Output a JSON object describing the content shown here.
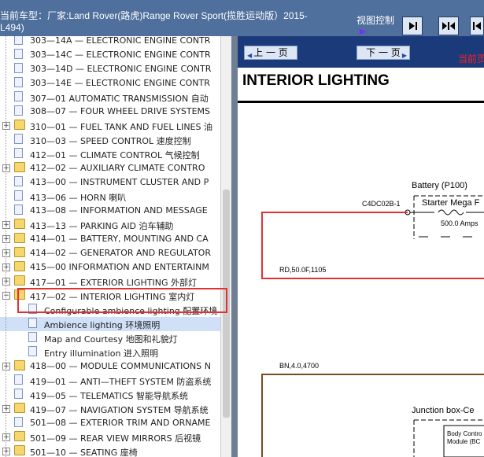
{
  "title": {
    "line1": "当前车型：厂家:Land Rover(路虎)Range Rover Sport(揽胜运动版）2015-",
    "line2": "L494)"
  },
  "view_control": {
    "label": "视图控制"
  },
  "tree": {
    "items": [
      {
        "label": "303—14A — ELECTRONIC ENGINE CONTR",
        "type": "doc",
        "expand": ""
      },
      {
        "label": "303—14C — ELECTRONIC ENGINE CONTR",
        "type": "doc",
        "expand": ""
      },
      {
        "label": "303—14D — ELECTRONIC ENGINE CONTR",
        "type": "doc",
        "expand": ""
      },
      {
        "label": "303—14E — ELECTRONIC ENGINE CONTR",
        "type": "doc",
        "expand": ""
      },
      {
        "label": "307—01 AUTOMATIC TRANSMISSION 自动",
        "type": "doc",
        "expand": ""
      },
      {
        "label": "308—07 — FOUR WHEEL DRIVE SYSTEMS",
        "type": "doc",
        "expand": ""
      },
      {
        "label": "310—01 — FUEL TANK AND FUEL LINES 油",
        "type": "folder",
        "expand": "+"
      },
      {
        "label": "310—03 — SPEED CONTROL 速度控制",
        "type": "doc",
        "expand": ""
      },
      {
        "label": "412—01 — CLIMATE CONTROL 气候控制",
        "type": "doc",
        "expand": ""
      },
      {
        "label": "412—02 — AUXILIARY CLIMATE CONTRO",
        "type": "folder",
        "expand": "+"
      },
      {
        "label": "413—00 — INSTRUMENT CLUSTER AND P",
        "type": "doc",
        "expand": ""
      },
      {
        "label": "413—06 — HORN 喇叭",
        "type": "doc",
        "expand": ""
      },
      {
        "label": "413—08 — INFORMATION AND MESSAGE",
        "type": "doc",
        "expand": ""
      },
      {
        "label": "413—13 — PARKING AID 泊车辅助",
        "type": "folder",
        "expand": "+"
      },
      {
        "label": "414—01 — BATTERY, MOUNTING AND CA",
        "type": "folder",
        "expand": "+"
      },
      {
        "label": "414—02 — GENERATOR AND REGULATOR",
        "type": "folder",
        "expand": "+"
      },
      {
        "label": "415—00 INFORMATION AND ENTERTAINM",
        "type": "folder",
        "expand": "+"
      },
      {
        "label": "417—01 — EXTERIOR LIGHTING 外部灯",
        "type": "folder",
        "expand": "+"
      },
      {
        "label": "417—02 — INTERIOR LIGHTING 室内灯",
        "type": "folder-open",
        "expand": "−"
      },
      {
        "label": "Configurable ambience lighting 配置环境",
        "type": "child",
        "expand": ""
      },
      {
        "label": "Ambience lighting 环境照明",
        "type": "child",
        "expand": "",
        "selected": true
      },
      {
        "label": "Map and Courtesy 地图和礼貌灯",
        "type": "child",
        "expand": ""
      },
      {
        "label": "Entry illumination 进入照明",
        "type": "child",
        "expand": ""
      },
      {
        "label": "418—00 — MODULE COMMUNICATIONS N",
        "type": "folder",
        "expand": "+"
      },
      {
        "label": "419—01 — ANTI—THEFT SYSTEM 防盗系统",
        "type": "doc",
        "expand": ""
      },
      {
        "label": "419—05 — TELEMATICS 智能导航系统",
        "type": "doc",
        "expand": ""
      },
      {
        "label": "419—07 — NAVIGATION SYSTEM 导航系统",
        "type": "folder",
        "expand": "+"
      },
      {
        "label": "501—08 — EXTERIOR TRIM AND ORNAME",
        "type": "doc",
        "expand": ""
      },
      {
        "label": "501—09 — REAR VIEW MIRRORS 后视镜",
        "type": "folder",
        "expand": "+"
      },
      {
        "label": "501—10 — SEATING 座椅",
        "type": "folder",
        "expand": "+"
      }
    ]
  },
  "nav": {
    "prev_label": "上 一 页",
    "next_label": "下 一 页",
    "current_page": "当前页"
  },
  "document": {
    "heading": "INTERIOR LIGHTING",
    "battery_label": "Battery (P100)",
    "connector_label": "C4DC02B-1",
    "starter_label": "Starter Mega F",
    "fuse_rating": "500.0 Amps",
    "wire1": "RD,50.0F,1105",
    "wire2": "BN,4.0,4700",
    "junction_label": "Junction box-Ce",
    "body_control_line1": "Body Contro",
    "body_control_line2": "Module (BC"
  },
  "colors": {
    "title_bg": "#4f6f9c",
    "nav_bg": "#1b3a7a",
    "highlight": "#e53030",
    "selection": "#cfe0f7"
  }
}
